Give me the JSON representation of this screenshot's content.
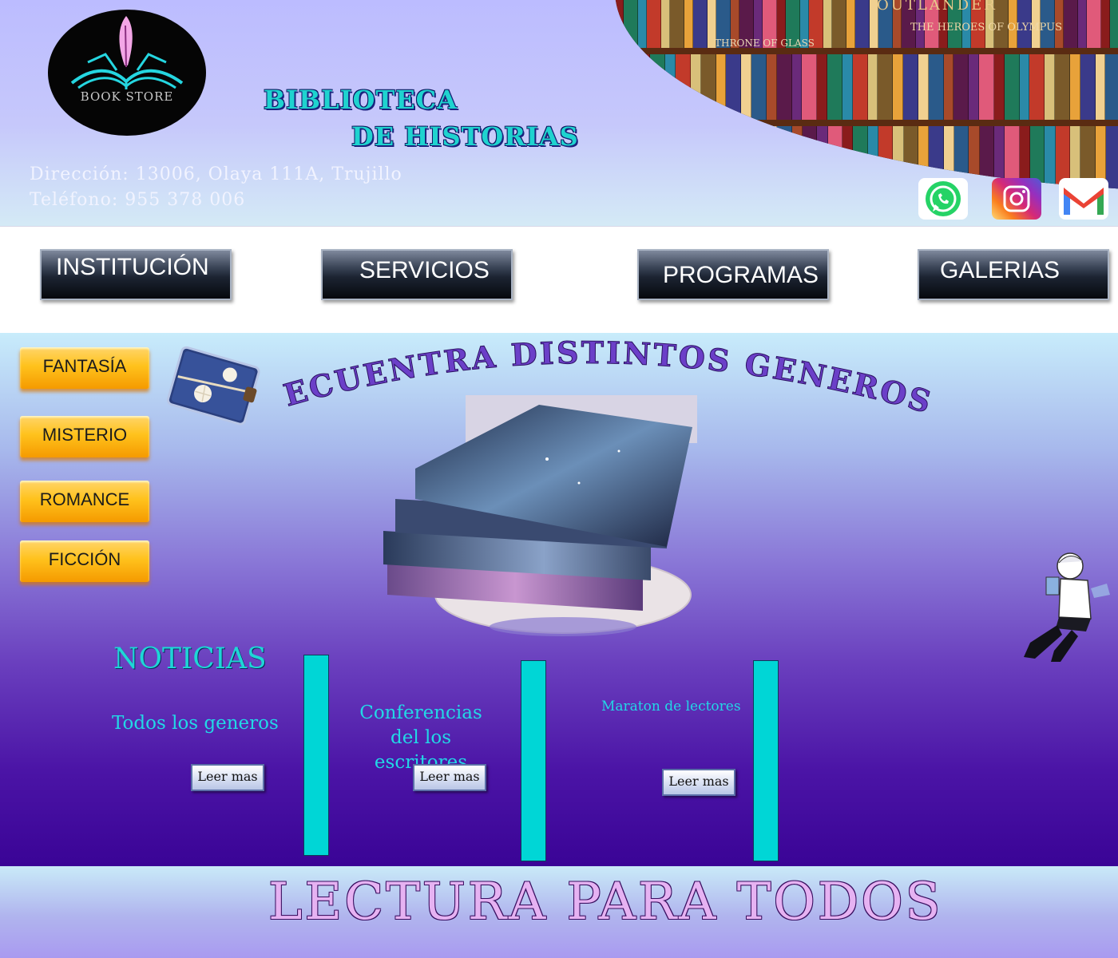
{
  "header": {
    "logo_text": "BOOK STORE",
    "title_line1": "BIBLIOTECA",
    "title_line2": "DE HISTORIAS",
    "address": "Dirección: 13006, Olaya 111A, Trujillo",
    "phone": "Teléfono: 955 378 006",
    "shelf_titles": [
      "OUTLANDER",
      "THE HEROES OF OLYMPUS",
      "THRONE OF GLASS"
    ],
    "social": [
      {
        "name": "whatsapp-icon"
      },
      {
        "name": "instagram-icon"
      },
      {
        "name": "gmail-icon"
      }
    ]
  },
  "nav": {
    "items": [
      {
        "label": "INSTITUCIÓN"
      },
      {
        "label": "SERVICIOS"
      },
      {
        "label": "PROGRAMAS"
      },
      {
        "label": "GALERIAS"
      }
    ]
  },
  "genres": {
    "items": [
      {
        "label": "FANTASÍA"
      },
      {
        "label": "MISTERIO"
      },
      {
        "label": "ROMANCE"
      },
      {
        "label": "FICCIÓN"
      }
    ]
  },
  "hero": {
    "curved_title": "ECUENTRA DISTINTOS GENEROS"
  },
  "news": {
    "title": "NOTICIAS",
    "items": [
      {
        "text": "Todos los generos",
        "button": "Leer mas"
      },
      {
        "text": "Conferencias del los escritores",
        "button": "Leer mas"
      },
      {
        "text": "Maraton de lectores",
        "button": "Leer mas"
      }
    ]
  },
  "footer": {
    "text": "LECTURA PARA TODOS"
  },
  "colors": {
    "accent_cyan": "#1fd3cf",
    "genre_gold": "#ffc21c",
    "nav_dark": "#1c2432",
    "footer_pink": "#e6b2f2"
  }
}
